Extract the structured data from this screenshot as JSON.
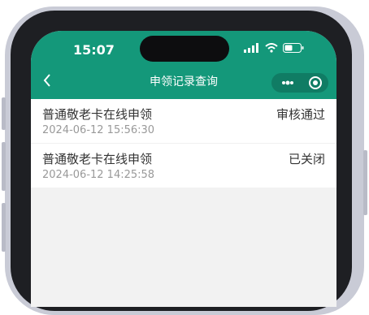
{
  "status_bar": {
    "time": "15:07"
  },
  "nav": {
    "title": "申领记录查询"
  },
  "records": [
    {
      "title": "普通敬老卡在线申领",
      "datetime": "2024-06-12 15:56:30",
      "status": "审核通过"
    },
    {
      "title": "普通敬老卡在线申领",
      "datetime": "2024-06-12 14:25:58",
      "status": "已关闭"
    }
  ],
  "colors": {
    "header": "#14987a",
    "frame": "#c9cbd6",
    "bezel": "#1e1f23",
    "content_bg": "#f2f2f2"
  },
  "icons": [
    "back-icon",
    "more-icon",
    "close-icon",
    "signal-icon",
    "wifi-icon",
    "battery-icon"
  ]
}
